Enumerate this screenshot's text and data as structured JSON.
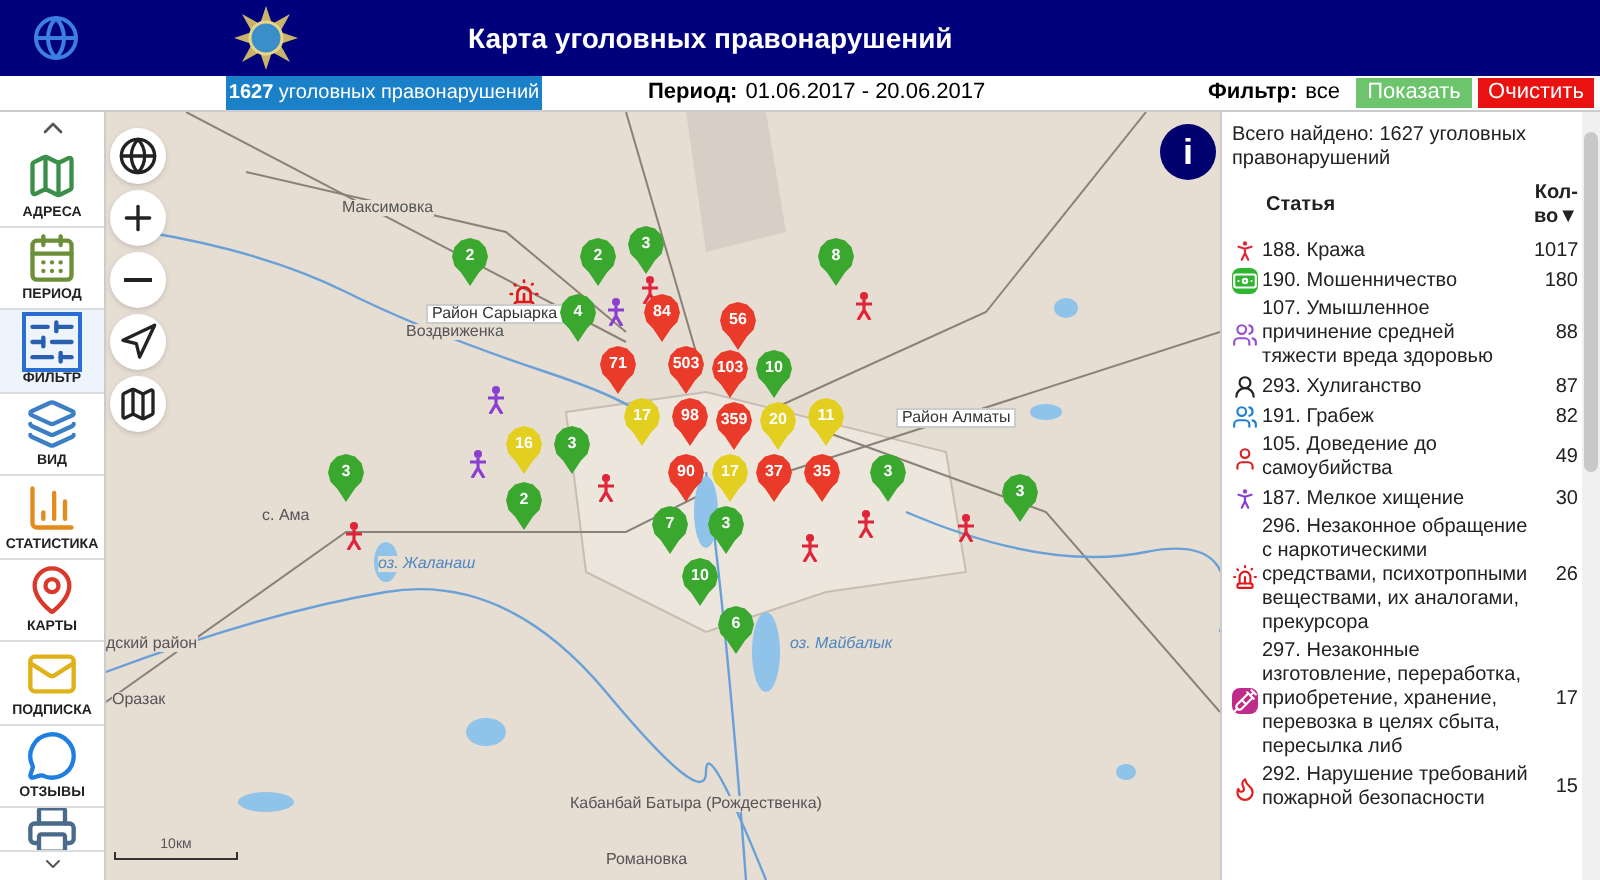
{
  "header": {
    "title": "Карта уголовных правонарушений"
  },
  "summary_bar": {
    "count_label": "**1627** уголовных правонарушений",
    "period_label": "Период:",
    "period_value": "01.06.2017 - 20.06.2017",
    "filter_label": "Фильтр:",
    "filter_value": "все",
    "buttons": [
      {
        "label": "Показать",
        "kind": "show"
      },
      {
        "label": "Очистить",
        "kind": "clear"
      }
    ]
  },
  "sidebar": {
    "items": [
      {
        "label": "АДРЕСА",
        "kind": "addresses",
        "selected": false
      },
      {
        "label": "ПЕРИОД",
        "kind": "period",
        "selected": false
      },
      {
        "label": "ФИЛЬТР",
        "kind": "filter",
        "selected": true
      },
      {
        "label": "ВИД",
        "kind": "layers",
        "selected": false
      },
      {
        "label": "СТАТИСТИКА",
        "kind": "stats",
        "selected": false
      },
      {
        "label": "КАРТЫ",
        "kind": "maps",
        "selected": false
      },
      {
        "label": "ПОДПИСКА",
        "kind": "subscribe",
        "selected": false
      },
      {
        "label": "ОТЗЫВЫ",
        "kind": "feedback",
        "selected": false
      },
      {
        "kind": "print",
        "selected": false
      }
    ]
  },
  "map": {
    "info_button": "i",
    "scale": "10км",
    "labels": [
      {
        "text": "Максимовка",
        "kind": "place"
      },
      {
        "text": "Район Сарыарка",
        "kind": "district"
      },
      {
        "text": "Воздвиженка",
        "kind": "place"
      },
      {
        "text": "Район Алматы",
        "kind": "district"
      },
      {
        "text": "с. Ама",
        "kind": "place"
      },
      {
        "text": "оз. Жаланаш",
        "kind": "lake"
      },
      {
        "text": "оз. Майбалык",
        "kind": "lake"
      },
      {
        "text": "Кабанбай Батыра (Рождественка)",
        "kind": "place"
      },
      {
        "text": "Романовка",
        "kind": "place"
      },
      {
        "text": "Оразак",
        "kind": "place"
      },
      {
        "text": "дский район",
        "kind": "place"
      }
    ],
    "markers": [
      {
        "count": "2",
        "color": "#3aa72f"
      },
      {
        "count": "2",
        "color": "#3aa72f"
      },
      {
        "count": "3",
        "color": "#3aa72f"
      },
      {
        "count": "8",
        "color": "#3aa72f"
      },
      {
        "count": "4",
        "color": "#3aa72f"
      },
      {
        "count": "84",
        "color": "#ea3a2a"
      },
      {
        "count": "56",
        "color": "#ea3a2a"
      },
      {
        "count": "71",
        "color": "#ea3a2a"
      },
      {
        "count": "503",
        "color": "#ea3a2a"
      },
      {
        "count": "103",
        "color": "#ea3a2a"
      },
      {
        "count": "10",
        "color": "#3aa72f"
      },
      {
        "count": "17",
        "color": "#e2cf1f"
      },
      {
        "count": "98",
        "color": "#ea3a2a"
      },
      {
        "count": "359",
        "color": "#ea3a2a"
      },
      {
        "count": "20",
        "color": "#e2cf1f"
      },
      {
        "count": "11",
        "color": "#e2cf1f"
      },
      {
        "count": "16",
        "color": "#e2cf1f"
      },
      {
        "count": "3",
        "color": "#3aa72f"
      },
      {
        "count": "3",
        "color": "#3aa72f"
      },
      {
        "count": "90",
        "color": "#ea3a2a"
      },
      {
        "count": "17",
        "color": "#e2cf1f"
      },
      {
        "count": "37",
        "color": "#ea3a2a"
      },
      {
        "count": "35",
        "color": "#ea3a2a"
      },
      {
        "count": "3",
        "color": "#3aa72f"
      },
      {
        "count": "3",
        "color": "#3aa72f"
      },
      {
        "count": "2",
        "color": "#3aa72f"
      },
      {
        "count": "7",
        "color": "#3aa72f"
      },
      {
        "count": "3",
        "color": "#3aa72f"
      },
      {
        "count": "10",
        "color": "#3aa72f"
      },
      {
        "count": "6",
        "color": "#3aa72f"
      }
    ]
  },
  "stats_panel": {
    "summary": "Всего найдено: 1627 уголовных правонарушений",
    "columns": [
      "Статья",
      "Кол-во▼"
    ],
    "rows": [
      {
        "article": "188. Кража",
        "count": "1017",
        "kind": "theft"
      },
      {
        "article": "190. Мошенничество",
        "count": "180",
        "kind": "fraud"
      },
      {
        "article": "107. Умышленное причинение средней тяжести вреда здоровью",
        "count": "88",
        "kind": "assault"
      },
      {
        "article": "293. Хулиганство",
        "count": "87",
        "kind": "hooliganism"
      },
      {
        "article": "191. Грабеж",
        "count": "82",
        "kind": "robbery"
      },
      {
        "article": "105. Доведение до самоубийства",
        "count": "49",
        "kind": "suicide"
      },
      {
        "article": "187. Мелкое хищение",
        "count": "30",
        "kind": "petty_theft"
      },
      {
        "article": "296. Незаконное обращение с наркотическими средствами, психотропными веществами, их аналогами, прекурсора",
        "count": "26",
        "kind": "drugs"
      },
      {
        "article": "297. Незаконные изготовление, переработка, приобретение, хранение, перевозка в целях сбыта, пересылка либ",
        "count": "17",
        "kind": "drug_trafficking"
      },
      {
        "article": "292. Нарушение требований пожарной безопасности",
        "count": "15",
        "kind": "fire"
      }
    ]
  }
}
